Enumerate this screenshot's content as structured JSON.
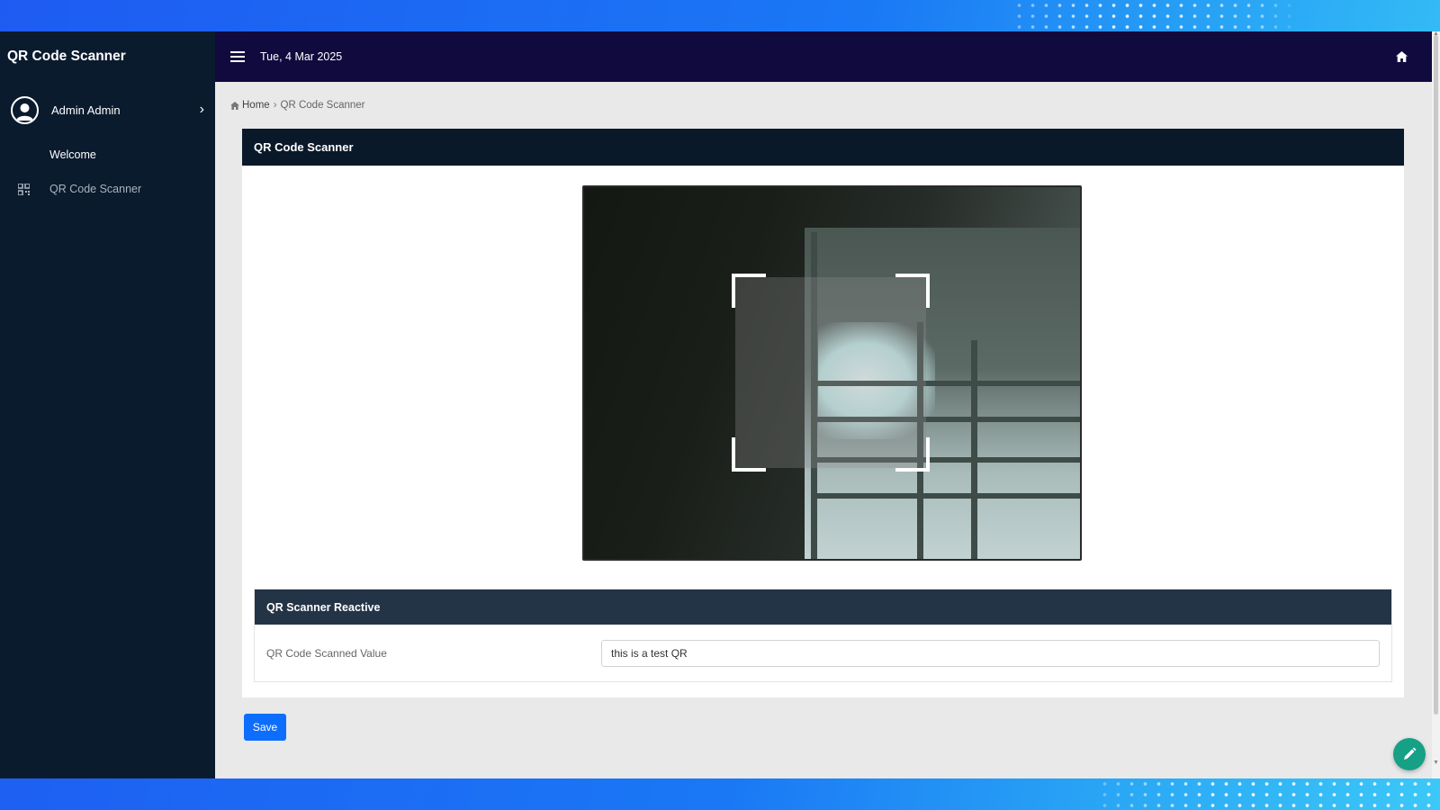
{
  "sidebar": {
    "brand": "QR Code Scanner",
    "user_name": "Admin Admin",
    "items": [
      {
        "label": "Welcome",
        "icon": "none"
      },
      {
        "label": "QR Code Scanner",
        "icon": "qrcode-icon"
      }
    ]
  },
  "topbar": {
    "date": "Tue, 4 Mar 2025",
    "home_icon": "home-icon"
  },
  "breadcrumb": {
    "home": "Home",
    "current": "QR Code Scanner"
  },
  "card": {
    "title": "QR Code Scanner"
  },
  "reactive_section": {
    "title": "QR Scanner Reactive",
    "field_label": "QR Code Scanned Value",
    "field_value": "this is a test QR"
  },
  "actions": {
    "save_label": "Save"
  },
  "colors": {
    "sidebar_bg": "#0b1b2e",
    "topbar_bg": "#110a3e",
    "card_header_bg": "#0a1929",
    "sub_header_bg": "#243447",
    "primary": "#0d6efd",
    "fab": "#16a085"
  }
}
